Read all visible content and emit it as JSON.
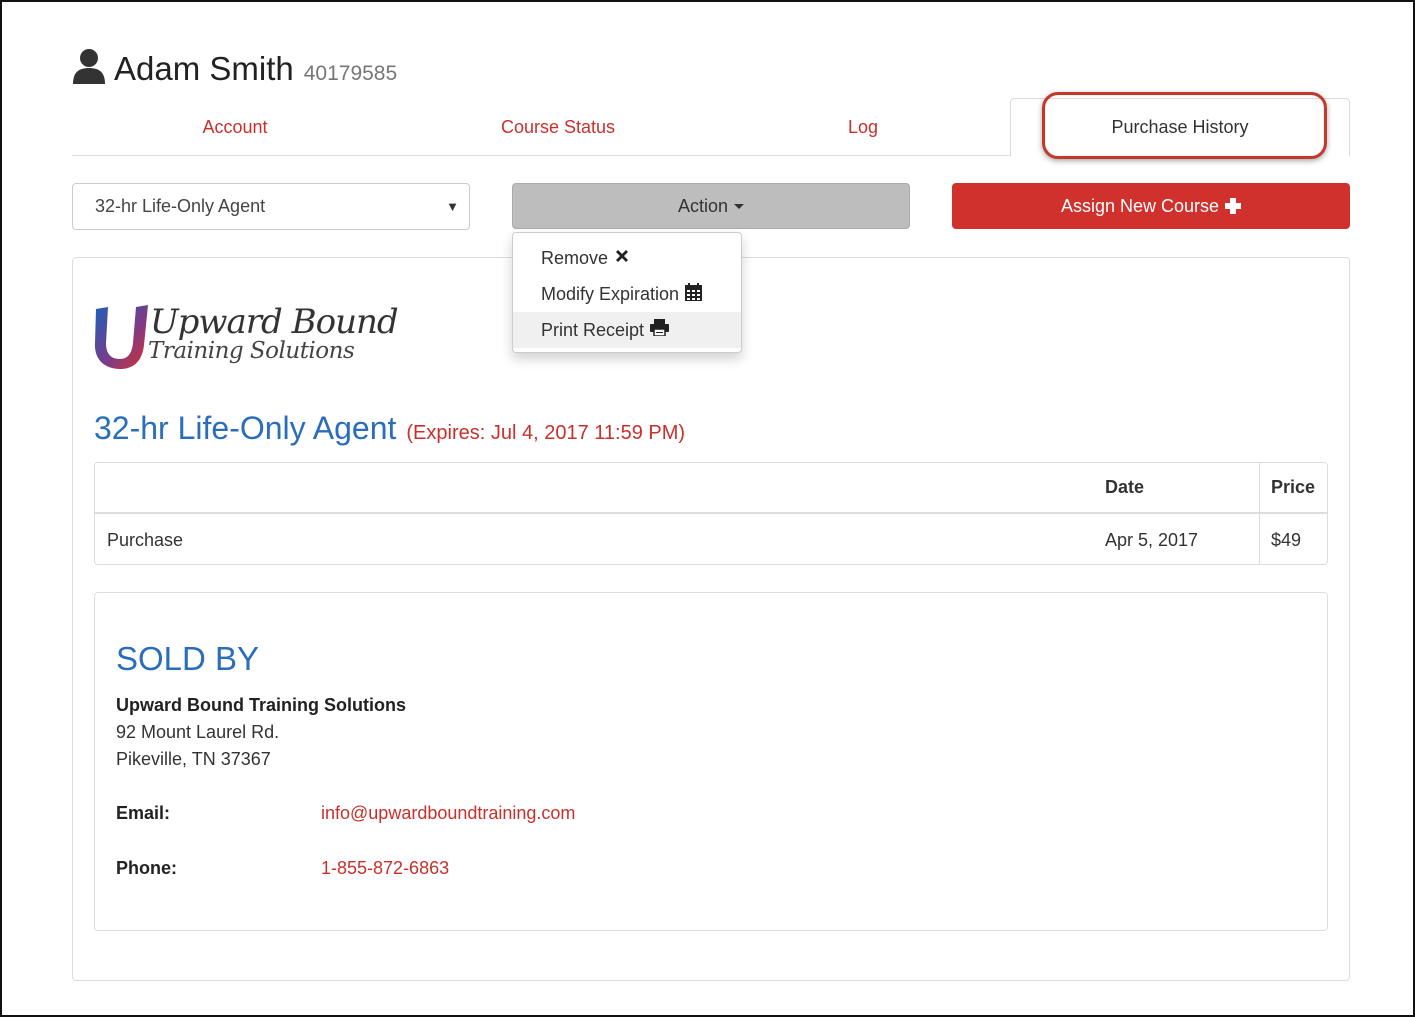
{
  "user": {
    "name": "Adam Smith",
    "id": "40179585",
    "icon": "user-silhouette-icon"
  },
  "tabs": [
    {
      "label": "Account",
      "active": false
    },
    {
      "label": "Course Status",
      "active": false
    },
    {
      "label": "Log",
      "active": false
    },
    {
      "label": "Purchase History",
      "active": true
    }
  ],
  "controls": {
    "course_select_value": "32-hr Life-Only Agent",
    "action_label": "Action",
    "assign_label": "Assign New Course"
  },
  "action_menu": {
    "items": [
      {
        "label": "Remove",
        "icon": "times-icon"
      },
      {
        "label": "Modify Expiration",
        "icon": "calendar-icon"
      },
      {
        "label": "Print Receipt",
        "icon": "print-icon"
      }
    ]
  },
  "logo": {
    "line1": "Upward Bound",
    "line2": "Training Solutions"
  },
  "course": {
    "name": "32-hr Life-Only Agent",
    "expires": "(Expires: Jul 4, 2017 11:59 PM)"
  },
  "table": {
    "headers": [
      "",
      "Date",
      "Price"
    ],
    "rows": [
      [
        "Purchase",
        "Apr 5, 2017",
        "$49"
      ]
    ]
  },
  "sold_by": {
    "title": "SOLD BY",
    "company": "Upward Bound Training Solutions",
    "address1": "92 Mount Laurel Rd.",
    "address2": "Pikeville, TN 37367",
    "email_label": "Email:",
    "email": "info@upwardboundtraining.com",
    "phone_label": "Phone:",
    "phone": "1-855-872-6863"
  },
  "colors": {
    "accent_red": "#d0312d",
    "link_red": "#c9302c",
    "title_blue": "#2a6ebb",
    "annotation_red": "#c0392b"
  }
}
